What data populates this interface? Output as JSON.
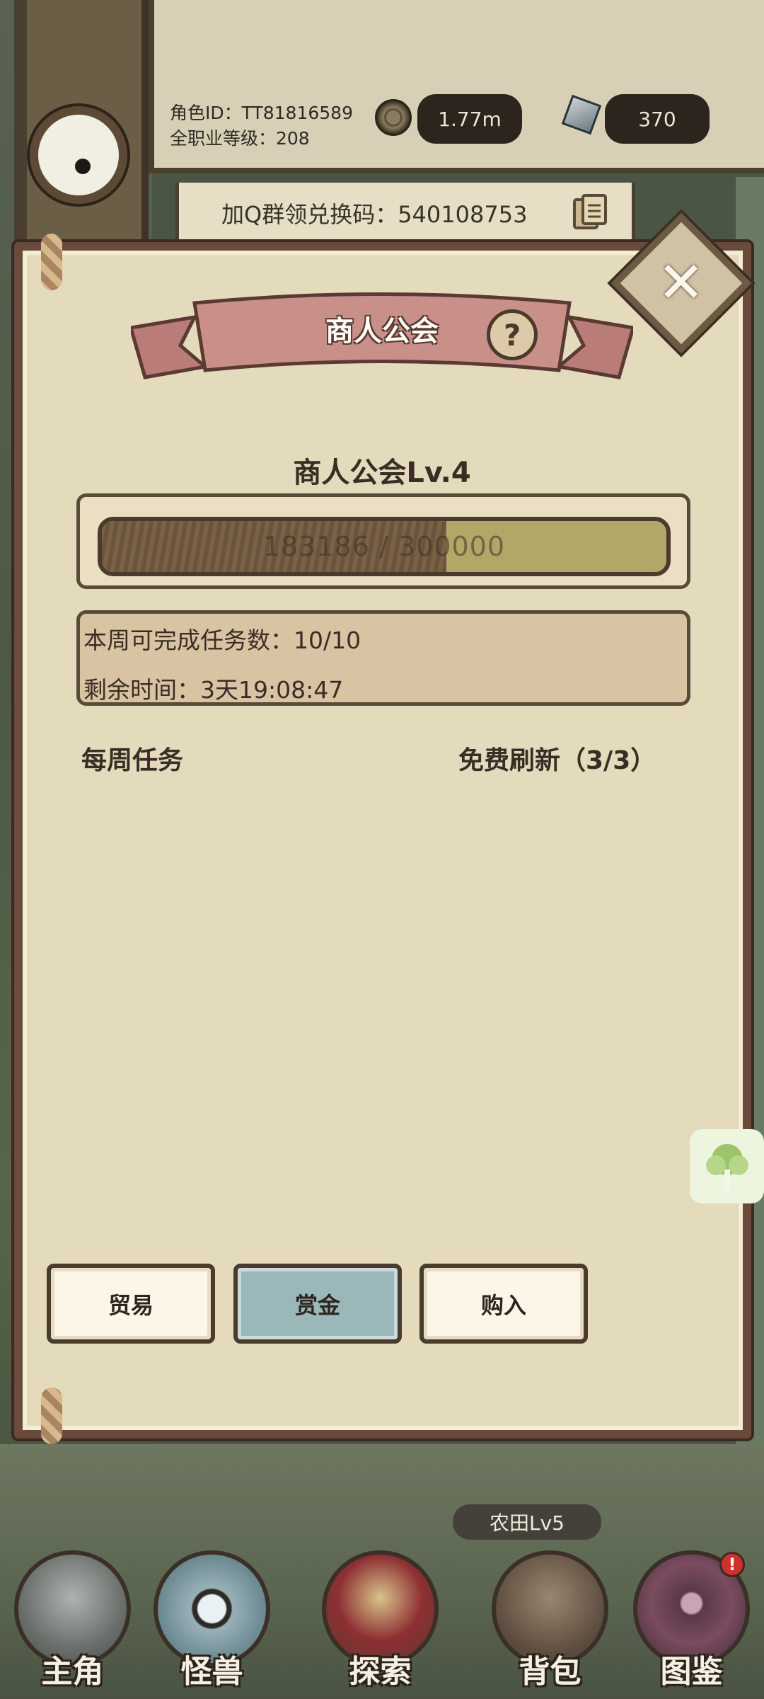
{
  "hud": {
    "role_id": "角色ID：TT81816589",
    "total_level": "全职业等级：208",
    "gold": "1.77m",
    "gems": "370",
    "redeem_code": "加Q群领兑换码：540108753"
  },
  "panel": {
    "title": "商人公会",
    "close_symbol": "✕",
    "help_symbol": "?",
    "level_title": "商人公会Lv.4",
    "progress": {
      "current": 183186,
      "max": 300000,
      "label": "183186 / 300000",
      "fraction": 0.6106
    },
    "weekly_tasks_done": "本周可完成任务数：10/10",
    "time_left": "剩余时间：3天19:08:47",
    "weekly_tasks_label": "每周任务",
    "free_refresh": "免费刷新（3/3）",
    "tabs": [
      "贸易",
      "赏金",
      "购入"
    ],
    "active_tab": "赏金"
  },
  "world": {
    "farm_label": "农田Lv5"
  },
  "nav": {
    "items": [
      "主角",
      "怪兽",
      "探索",
      "背包",
      "图鉴"
    ],
    "badge": "!"
  },
  "colors": {
    "panel_bg": "#e4dbbd",
    "ribbon": "#c9908a",
    "active_tab": "#9ab8ba",
    "progress_fill": "#7a6247",
    "progress_track": "#b3a768"
  },
  "icons": {
    "coin": "coin-icon",
    "gem": "gem-icon",
    "copy": "copy-icon",
    "help": "help-icon",
    "close": "close-icon",
    "leaf": "tree-icon"
  }
}
